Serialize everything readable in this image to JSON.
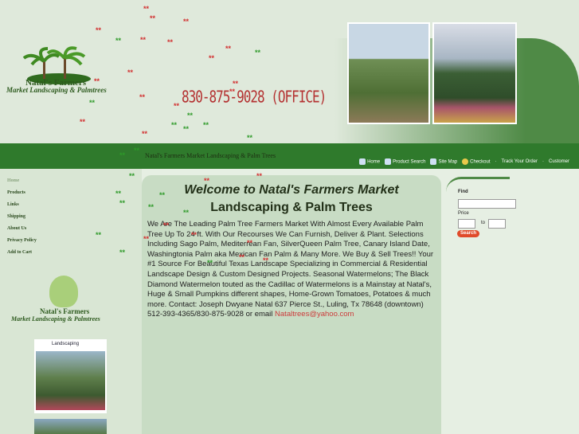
{
  "header": {
    "logo_name": "Natal's Farmers",
    "logo_sub": "Market Landscaping & Palmtrees",
    "phone": "830-875-9028 (OFFICE)",
    "bar_title": "Natal's Farmers Market Landscaping & Palm Trees"
  },
  "toplinks": [
    "Home",
    "Product Search",
    "Site Map",
    "Checkout",
    "Track Your Order",
    "Customer"
  ],
  "nav": [
    "Home",
    "Products",
    "Links",
    "Shipping",
    "About Us",
    "Privacy Policy",
    "Add to Cart"
  ],
  "sidebar": {
    "logo_name": "Natal's Farmers",
    "logo_sub": "Market Landscaping & Palmtrees",
    "thumb_caption": "Landscaping"
  },
  "main": {
    "title_line1": "Welcome to Natal's Farmers Market",
    "title_line2": "Landscaping & Palm Trees",
    "body": "We Are The Leading Palm Tree Farmers Market With Almost Every Available Palm Tree Up To 24 ft. With Our Recourses We Can Furnish, Deliver & Plant. Selections Including Sago Palm, Mediterrean Fan, SilverQueen Palm Tree, Canary Island Date, Washingtonia Palm aka Mexican Fan Palm & Many More.  We Buy & Sell Trees!! Your #1 Source For Beautiful Texas Landscape Specializing in Commercial & Residential Landscape Design & Custom Designed Projects. Seasonal Watermelons; The Black Diamond Watermelon touted as the Cadillac of Watermelons is a Mainstay at Natal's, Huge & Small Pumpkins different shapes, Home-Grown Tomatoes, Potatoes & much more.  Contact: Joseph Dwyane Natal 637 Pierce St., Luling, Tx 78648 (downtown)  512-393-4365/830-875-9028 or email ",
    "email": "Nataltrees@yahoo.com"
  },
  "search": {
    "find_label": "Find",
    "price_label": "Price",
    "to_label": "to",
    "button": "Search"
  },
  "colors": {
    "header_green": "#4f8a46",
    "bar_green": "#2f7a2c",
    "page_bg": "#e6efe3",
    "content_bg": "#c8dcc4",
    "snow_red": "#d23030",
    "snow_green": "#2f9a2a"
  }
}
